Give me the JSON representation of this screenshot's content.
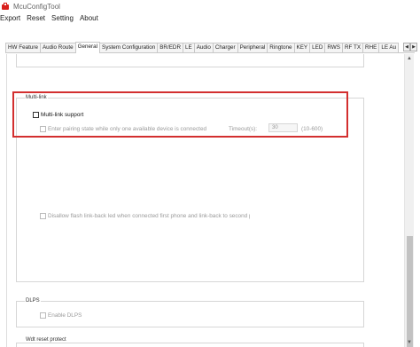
{
  "window": {
    "title": "McuConfigTool"
  },
  "menu": [
    "Export",
    "Reset",
    "Setting",
    "About"
  ],
  "tabs": [
    {
      "label": "HW Feature",
      "active": false
    },
    {
      "label": "Audio Route",
      "active": false
    },
    {
      "label": "General",
      "active": true
    },
    {
      "label": "System Configuration",
      "active": false
    },
    {
      "label": "BR/EDR",
      "active": false
    },
    {
      "label": "LE",
      "active": false
    },
    {
      "label": "Audio",
      "active": false
    },
    {
      "label": "Charger",
      "active": false
    },
    {
      "label": "Peripheral",
      "active": false
    },
    {
      "label": "Ringtone",
      "active": false
    },
    {
      "label": "KEY",
      "active": false
    },
    {
      "label": "LED",
      "active": false
    },
    {
      "label": "RWS",
      "active": false
    },
    {
      "label": "RF TX",
      "active": false
    },
    {
      "label": "RHE",
      "active": false
    },
    {
      "label": "LE Au",
      "active": false
    }
  ],
  "multilink": {
    "group_title": "Multi-link",
    "support_label": "Multi-link support",
    "enter_pairing_label": "Enter pairing state while only one available device is connected",
    "timeout_label": "Timeout(s):",
    "timeout_value": "30",
    "timeout_range": "(10-600)",
    "disallow_label": "Disallow flash link-back led when connected first phone and link-back to second phone"
  },
  "dlps": {
    "group_title": "DLPS",
    "enable_label": "Enable DLPS"
  },
  "wdt": {
    "group_title": "Wdt reset protect"
  },
  "colors": {
    "highlight": "#d32f2f",
    "app_icon": "#d9201c"
  }
}
